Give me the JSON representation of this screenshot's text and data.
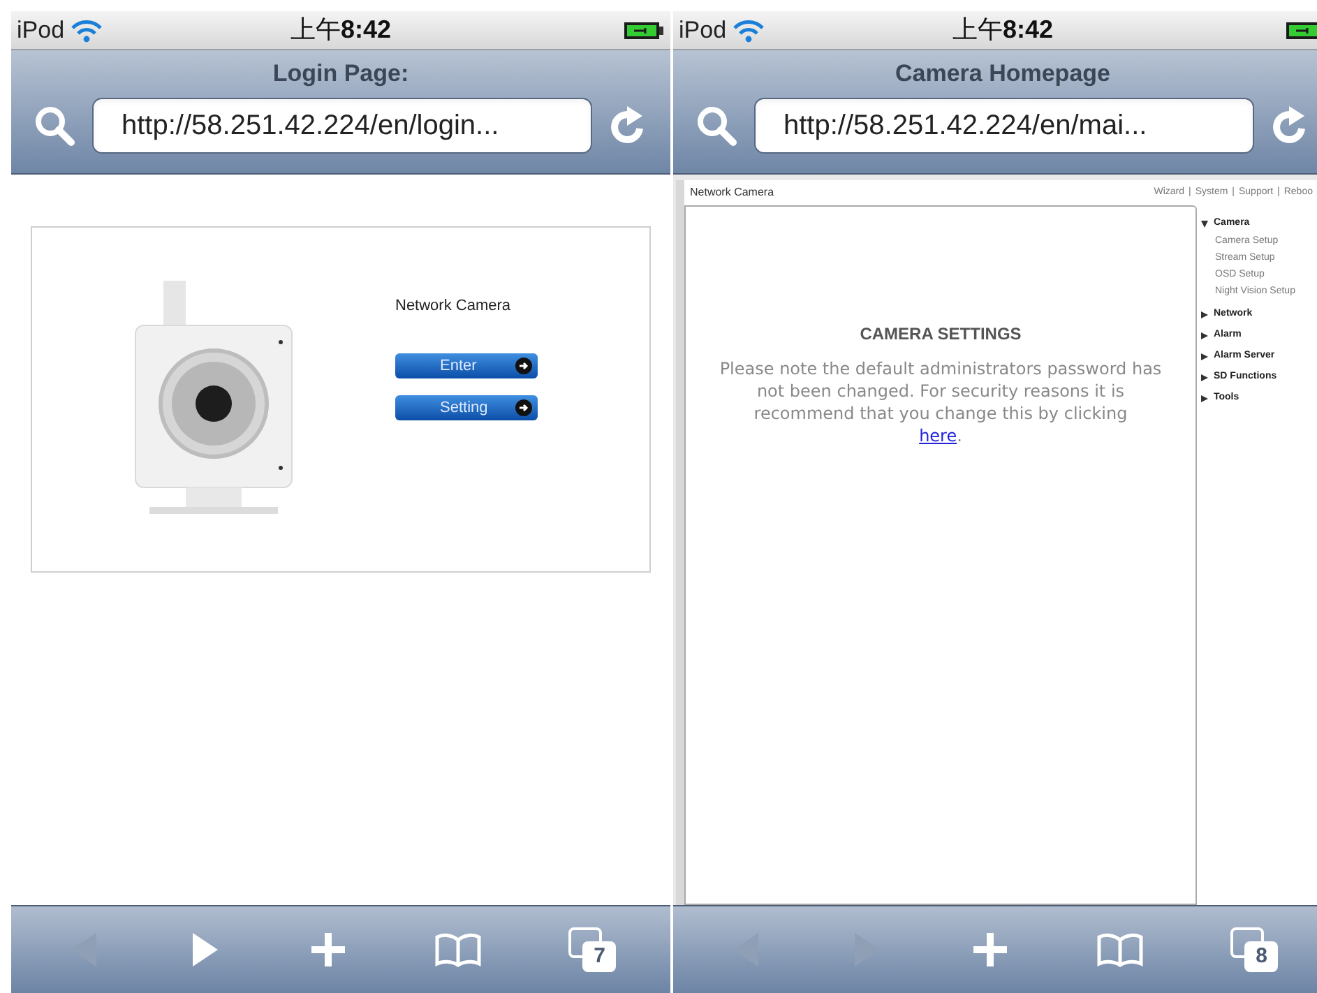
{
  "screens": [
    {
      "status": {
        "carrier": "iPod",
        "time": "上午**8:42**"
      },
      "title": "Login Page:",
      "url": "http://58.251.42.224/en/login...",
      "page": {
        "kind": "login",
        "heading": "Network Camera",
        "buttons": [
          "Enter",
          "Setting"
        ]
      },
      "toolbar": {
        "back_enabled": false,
        "forward_enabled": true,
        "tab_count": "7"
      }
    },
    {
      "status": {
        "carrier": "iPod",
        "time": "上午**8:42**"
      },
      "title": "Camera Homepage",
      "url": "http://58.251.42.224/en/mai...",
      "page": {
        "kind": "settings",
        "site_title": "Network Camera",
        "nav_links": [
          "Wizard",
          "System",
          "Support",
          "Reboo"
        ],
        "separator": "|",
        "heading": "CAMERA SETTINGS",
        "message": "Please note the default administrators password has not been changed. For security reasons it is recommend that you change this by clicking",
        "link": "here",
        "after_link": ".",
        "menu": [
          {
            "label": "Camera",
            "expanded": true,
            "children": [
              {
                "label": "Camera Setup"
              },
              {
                "label": "Stream Setup"
              },
              {
                "label": "OSD Setup"
              },
              {
                "label": "Night Vision Setup"
              }
            ]
          },
          {
            "label": "Network",
            "expanded": false
          },
          {
            "label": "Alarm",
            "expanded": false
          },
          {
            "label": "Alarm Server",
            "expanded": false
          },
          {
            "label": "SD Functions",
            "expanded": false
          },
          {
            "label": "Tools",
            "expanded": false
          }
        ]
      },
      "toolbar": {
        "back_enabled": false,
        "forward_enabled": false,
        "tab_count": "8"
      }
    }
  ]
}
